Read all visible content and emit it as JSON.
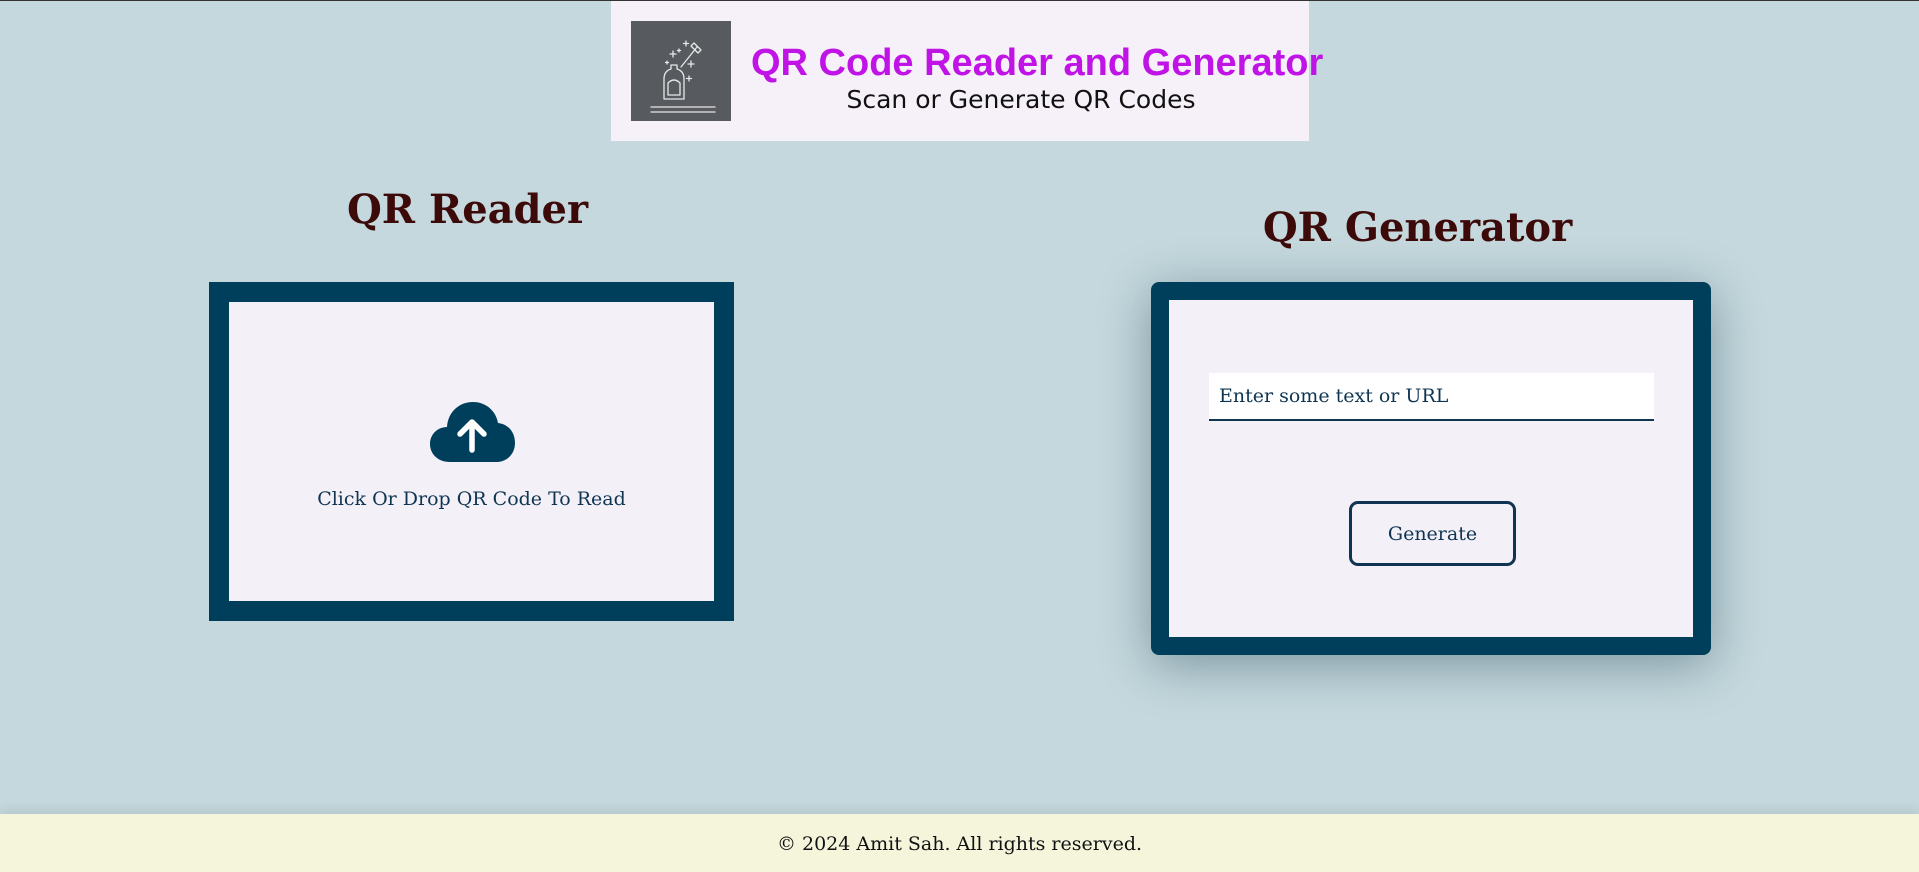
{
  "header": {
    "title": "QR Code Reader and Generator",
    "subtitle": "Scan or Generate QR Codes",
    "logo_icon": "magic-wand-sparkle-icon"
  },
  "reader": {
    "heading": "QR Reader",
    "upload_label": "Click Or Drop QR Code To Read",
    "upload_icon": "cloud-upload-icon"
  },
  "generator": {
    "heading": "QR Generator",
    "input_placeholder": "Enter some text or URL",
    "input_value": "",
    "button_label": "Generate"
  },
  "footer": {
    "copyright": "© 2024 Amit Sah. All rights reserved."
  },
  "colors": {
    "background": "#c4d8dd",
    "accent_dark": "#003f5c",
    "title_purple": "#c014e6",
    "heading_maroon": "#3d0a0a",
    "panel": "#f4f0f8",
    "footer_bg": "#f5f5dc"
  }
}
